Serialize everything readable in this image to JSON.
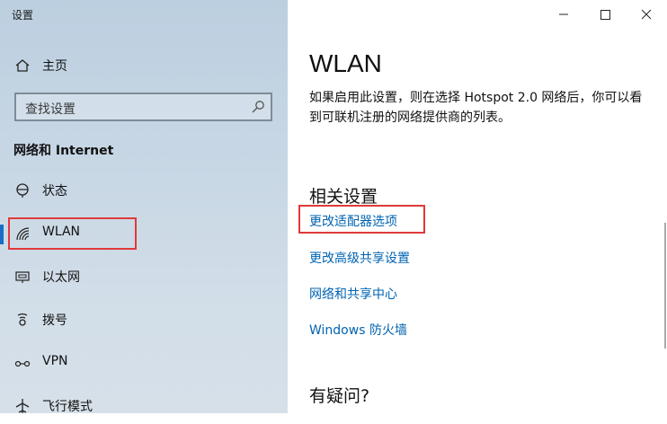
{
  "window": {
    "title": "设置"
  },
  "sidebar": {
    "home_label": "主页",
    "search_placeholder": "查找设置",
    "section_title": "网络和 Internet",
    "items": [
      {
        "label": "状态",
        "icon": "status-icon"
      },
      {
        "label": "WLAN",
        "icon": "wifi-icon",
        "active": true
      },
      {
        "label": "以太网",
        "icon": "ethernet-icon"
      },
      {
        "label": "拨号",
        "icon": "dialup-icon"
      },
      {
        "label": "VPN",
        "icon": "vpn-icon"
      },
      {
        "label": "飞行模式",
        "icon": "airplane-icon"
      }
    ]
  },
  "main": {
    "title": "WLAN",
    "description": "如果启用此设置，则在选择 Hotspot 2.0 网络后，你可以看到可联机注册的网络提供商的列表。",
    "related_title": "相关设置",
    "links": [
      "更改适配器选项",
      "更改高级共享设置",
      "网络和共享中心",
      "Windows 防火墙"
    ],
    "faq_title": "有疑问?"
  },
  "colors": {
    "accent": "#0063b1",
    "highlight_box": "#e03a3a",
    "active_indicator": "#1a6fc4"
  }
}
